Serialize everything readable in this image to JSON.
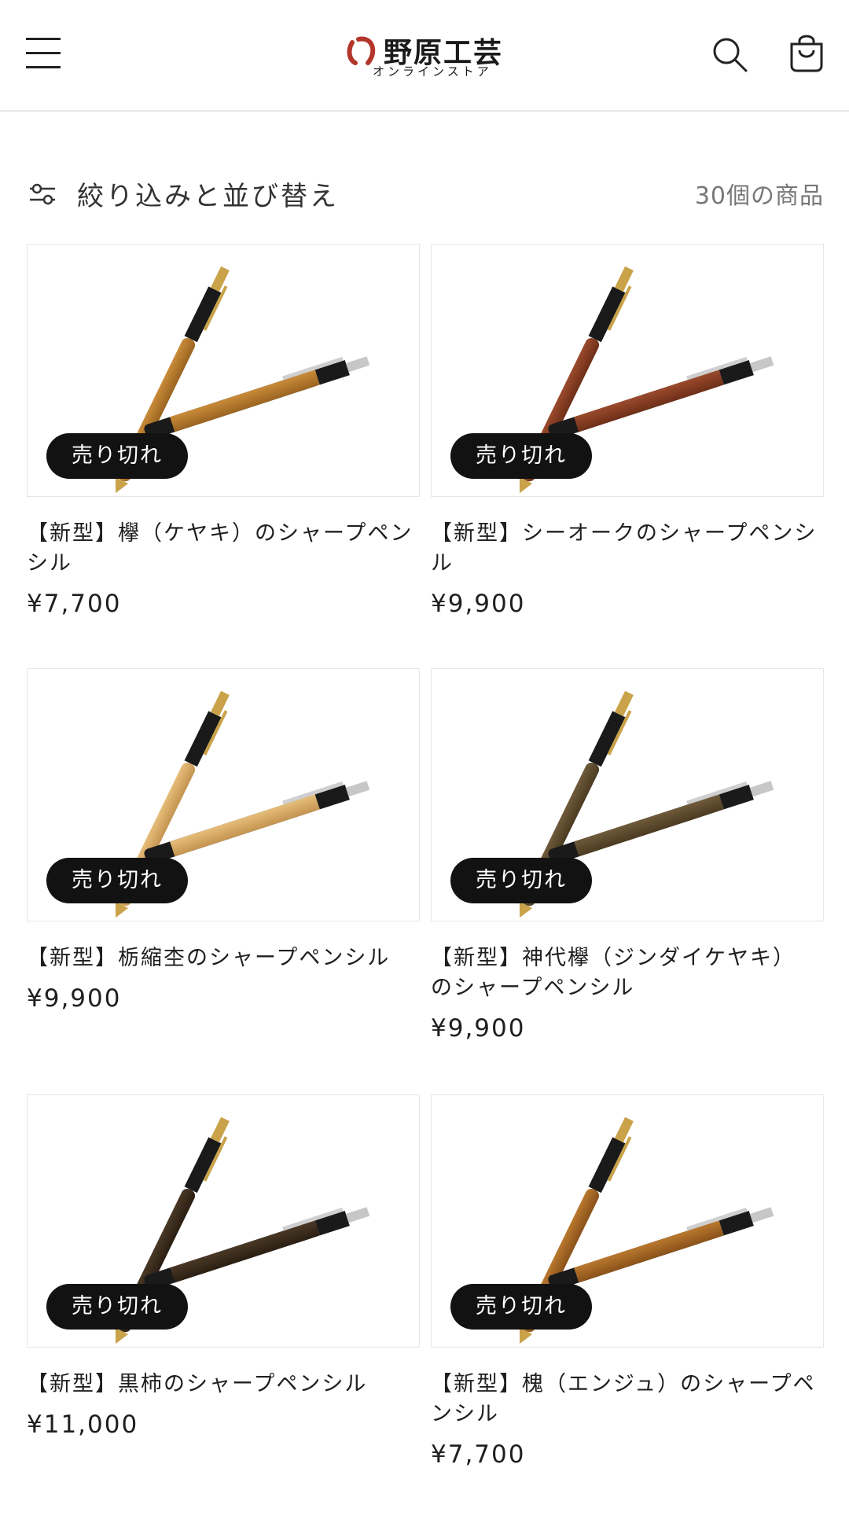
{
  "header": {
    "logo_name": "野原工芸",
    "logo_sub": "オンラインストア"
  },
  "toolbar": {
    "filter_label": "絞り込みと並び替え",
    "product_count": "30個の商品"
  },
  "colors": {
    "badge_bg": "#121212",
    "logo_red": "#b3362c"
  },
  "products": [
    {
      "title": "【新型】欅（ケヤキ）のシャープペンシル",
      "price": "¥7,700",
      "badge": "売り切れ",
      "wood_color": "#c98b3a",
      "wood_dark": "#9a6420"
    },
    {
      "title": "【新型】シーオークのシャープペンシル",
      "price": "¥9,900",
      "badge": "売り切れ",
      "wood_color": "#9a4a2c",
      "wood_dark": "#6e2f18"
    },
    {
      "title": "【新型】栃縮杢のシャープペンシル",
      "price": "¥9,900",
      "badge": "売り切れ",
      "wood_color": "#e6bd7a",
      "wood_dark": "#c49450"
    },
    {
      "title": "【新型】神代欅（ジンダイケヤキ）のシャープペンシル",
      "price": "¥9,900",
      "badge": "売り切れ",
      "wood_color": "#6f5a3a",
      "wood_dark": "#4b3b22"
    },
    {
      "title": "【新型】黒柿のシャープペンシル",
      "price": "¥11,000",
      "badge": "売り切れ",
      "wood_color": "#4a3826",
      "wood_dark": "#2a1e12"
    },
    {
      "title": "【新型】槐（エンジュ）のシャープペンシル",
      "price": "¥7,700",
      "badge": "売り切れ",
      "wood_color": "#b9782e",
      "wood_dark": "#8a521a"
    }
  ]
}
